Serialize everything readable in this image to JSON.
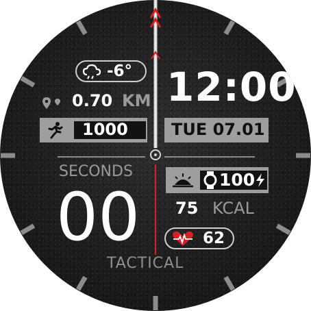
{
  "weather": {
    "temp": "-6°",
    "icon": "cloud-rain-icon"
  },
  "distance": {
    "value": "0.70",
    "unit": "KM",
    "icon": "map-pin-icon"
  },
  "steps": {
    "value": "1000",
    "icon": "running-person-icon"
  },
  "time": {
    "value": "12:00"
  },
  "date": {
    "value": "TUE 07.01"
  },
  "seconds": {
    "label": "SECONDS",
    "value": "00"
  },
  "battery": {
    "value": "100",
    "icon": "watch-icon",
    "charging_icon": "lightning-icon",
    "sunrise_icon": "sunrise-icon"
  },
  "calories": {
    "value": "75",
    "unit": "KCAL"
  },
  "heart": {
    "value": "62",
    "icon": "heart-rate-icon"
  },
  "brand": {
    "label": "TACTICAL"
  },
  "colors": {
    "accent": "#d81f26",
    "band": "#9e9e9e",
    "text": "#ffffff",
    "muted": "#9a9a9a"
  }
}
